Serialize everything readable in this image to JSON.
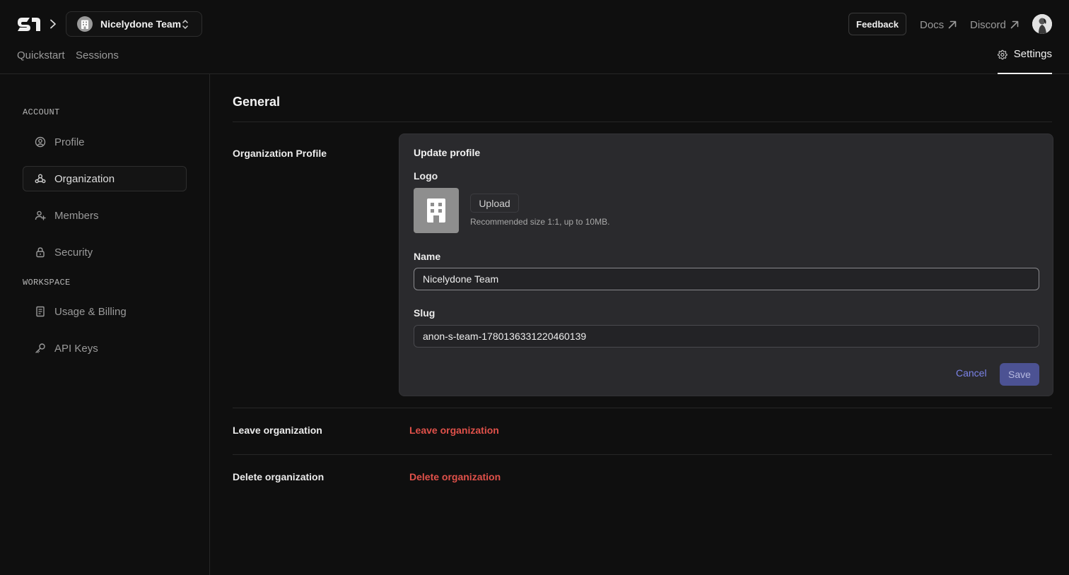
{
  "header": {
    "team_name": "Nicelydone Team",
    "feedback_label": "Feedback",
    "docs_label": "Docs",
    "discord_label": "Discord"
  },
  "nav": {
    "tabs": [
      {
        "label": "Quickstart"
      },
      {
        "label": "Sessions"
      }
    ],
    "settings_label": "Settings"
  },
  "sidebar": {
    "account_label": "ACCOUNT",
    "workspace_label": "WORKSPACE",
    "items": [
      {
        "label": "Profile",
        "icon": "user-circle-icon"
      },
      {
        "label": "Organization",
        "icon": "organization-icon",
        "active": true
      },
      {
        "label": "Members",
        "icon": "user-plus-icon"
      },
      {
        "label": "Security",
        "icon": "lock-icon"
      },
      {
        "label": "Usage & Billing",
        "icon": "receipt-icon"
      },
      {
        "label": "API Keys",
        "icon": "key-icon"
      }
    ]
  },
  "main": {
    "title": "General",
    "org_profile_label": "Organization Profile",
    "card": {
      "title": "Update profile",
      "logo_label": "Logo",
      "upload_label": "Upload",
      "upload_hint": "Recommended size 1:1, up to 10MB.",
      "name_label": "Name",
      "name_value": "Nicelydone Team",
      "slug_label": "Slug",
      "slug_value": "anon-s-team-1780136331220460139",
      "cancel_label": "Cancel",
      "save_label": "Save"
    },
    "leave": {
      "label": "Leave organization",
      "action": "Leave organization"
    },
    "delete": {
      "label": "Delete organization",
      "action": "Delete organization"
    }
  },
  "colors": {
    "background": "#0f0f0f",
    "card": "#2a2a2d",
    "accent": "#7b83e8",
    "save_button": "#4c5293",
    "danger": "#e0514a"
  }
}
